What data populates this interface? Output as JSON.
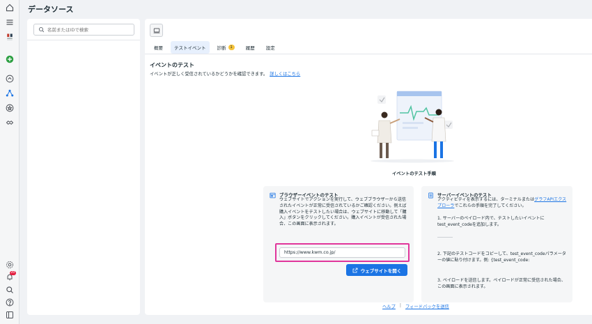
{
  "page": {
    "title": "データソース"
  },
  "search": {
    "placeholder": "名前またはIDで検索"
  },
  "tabs": [
    {
      "label": "概要"
    },
    {
      "label": "テストイベント"
    },
    {
      "label": "診断",
      "badge": "1"
    },
    {
      "label": "履歴"
    },
    {
      "label": "設定"
    }
  ],
  "section": {
    "title": "イベントのテスト",
    "description": "イベントが正しく受信されているかどうかを確認できます。",
    "learn_more": "詳しくはこちら"
  },
  "illustration": {
    "caption": "イベントのテスト手順"
  },
  "browser_card": {
    "title": "ブラウザーイベントのテスト",
    "body": "ウェブサイトでアクションを実行して、ウェブブラウザーから送信されたイベントが正常に受信されているかご確認ください。例えば購入イベントをテストしたい場合は、ウェブサイトに移動して「購入」ボタンをクリックしてください。購入イベントが受信された場合、この画面に表示されます。",
    "url_value": "https://www.kwm.co.jp/",
    "button_label": "ウェブサイトを開く"
  },
  "server_card": {
    "title": "サーバーイベントのテスト",
    "intro_before": "アクティビティを表示するには、ターミナルまたは",
    "intro_link": "グラフAPIエクスプローラ",
    "intro_after": "でこれらの手順を完了してください。",
    "step1": "1. サーバーのペイロード内で、テストしたいイベントにtest_event_codeを追加します。",
    "step2": "2. 下記のテストコードをコピーして、test_event_codeパラメーターの値に貼り付けます。例: {test_event_code:",
    "step3": "3. ペイロードを送信します。ペイロードが正常に受信された場合、この画面に表示されます。"
  },
  "footer": {
    "help": "ヘルプ",
    "separator": "|",
    "feedback": "フィードバックを送信"
  },
  "notifications": {
    "count": "20"
  },
  "colors": {
    "accent": "#1b74e4",
    "highlight": "#e0359b",
    "add": "#2ea043"
  }
}
